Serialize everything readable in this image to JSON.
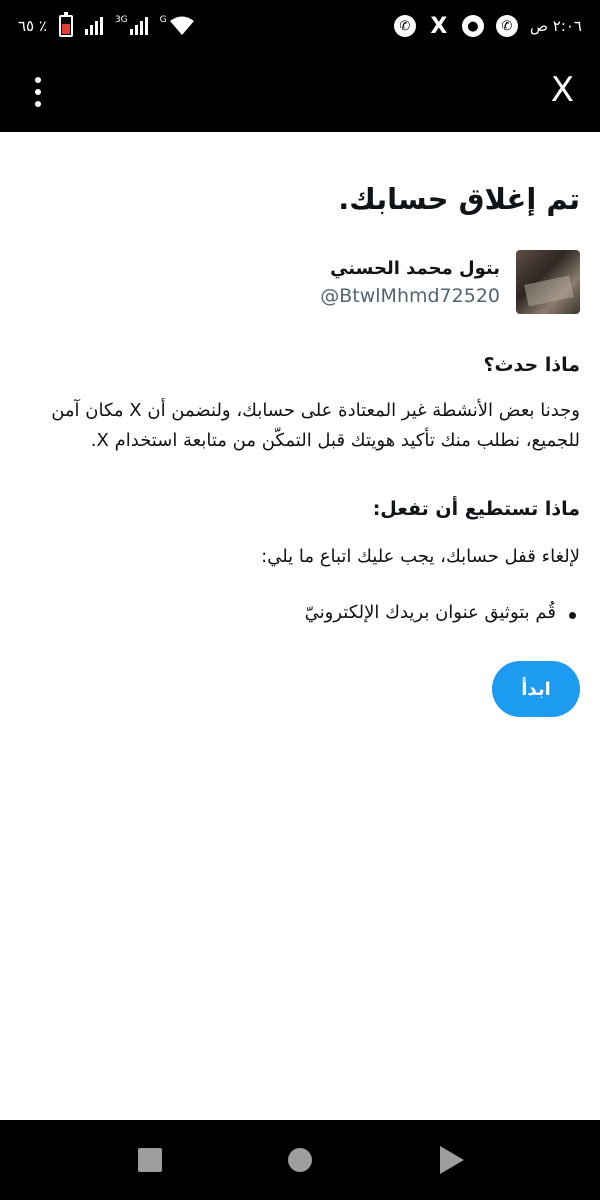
{
  "status_bar": {
    "time": "٢:٠٦ ص",
    "battery_text": "٦٥ ٪",
    "network_3g": "3G",
    "network_g": "G",
    "icons": [
      "whatsapp-icon",
      "message-icon",
      "x-icon",
      "whatsapp-icon",
      "wifi-icon",
      "signal-icon",
      "battery-icon"
    ]
  },
  "top_bar": {
    "close_label": "X",
    "menu_icon": "more-vertical-icon"
  },
  "main": {
    "title": "تم إغلاق حسابك.",
    "profile": {
      "display_name": "بتول محمد الحسني",
      "handle": "@BtwlMhmd72520"
    },
    "what_happened": {
      "heading": "ماذا حدث؟",
      "body": "وجدنا بعض الأنشطة غير المعتادة على حسابك، ولنضمن أن X مكان آمن للجميع، نطلب منك تأكيد هويتك قبل التمكّن من متابعة استخدام X."
    },
    "what_you_can_do": {
      "heading": "ماذا تستطيع أن تفعل:",
      "instruction": "لإلغاء قفل حسابك، يجب عليك اتباع ما يلي:",
      "steps": [
        "قُم بتوثيق عنوان بريدك الإلكترونيّ"
      ]
    },
    "start_button": "ابدأ"
  },
  "colors": {
    "accent": "#1d9bf0",
    "text_primary": "#0f1419",
    "text_secondary": "#536471",
    "bar_background": "#000000"
  }
}
